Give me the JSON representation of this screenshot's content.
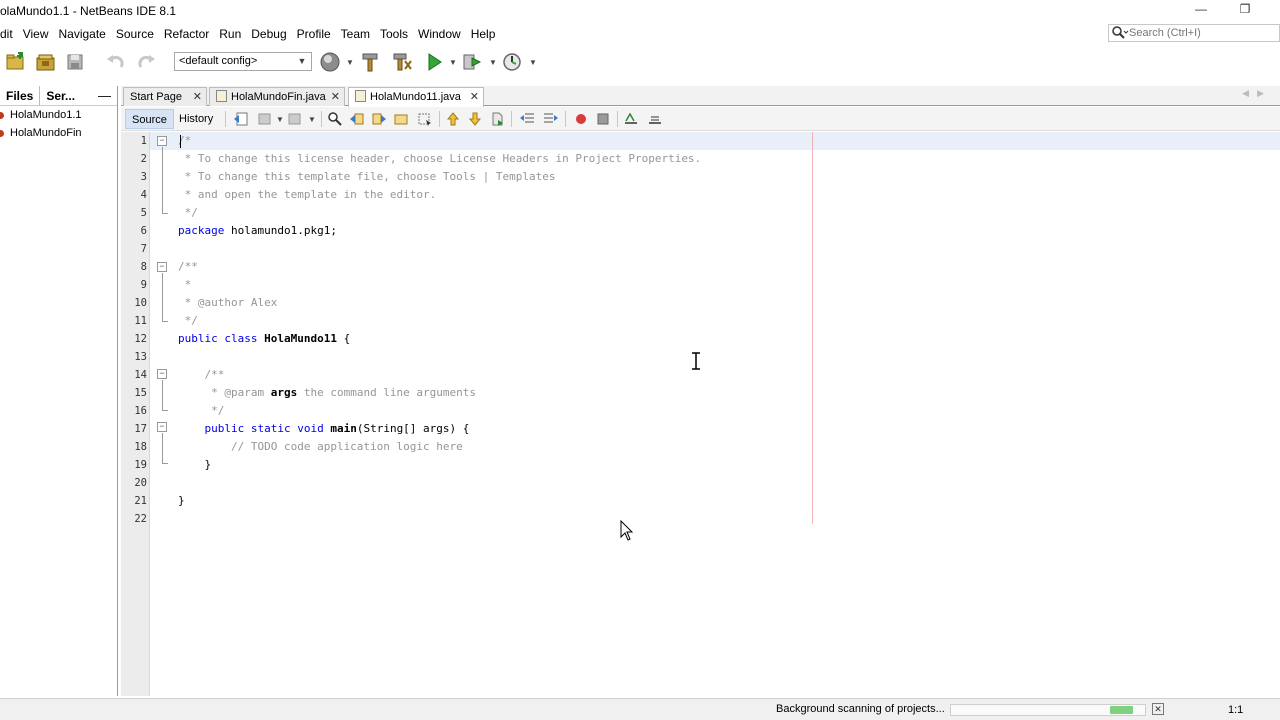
{
  "window": {
    "title": "olaMundo1.1 - NetBeans IDE 8.1",
    "minimize": "—",
    "restore": "❐"
  },
  "menu": [
    "dit",
    "View",
    "Navigate",
    "Source",
    "Refactor",
    "Run",
    "Debug",
    "Profile",
    "Team",
    "Tools",
    "Window",
    "Help"
  ],
  "search": {
    "placeholder": "Search (Ctrl+I)"
  },
  "toolbar": {
    "config": "<default config>"
  },
  "left_panel": {
    "tabs": [
      "Files",
      "Ser..."
    ],
    "minimize": "—",
    "projects": [
      "HolaMundo1.1",
      "HolaMundoFin"
    ]
  },
  "editor_tabs": [
    {
      "label": "Start Page",
      "close": "✕"
    },
    {
      "label": "HolaMundoFin.java",
      "close": "✕"
    },
    {
      "label": "HolaMundo11.java",
      "close": "✕"
    }
  ],
  "editor_toolbar": {
    "source": "Source",
    "history": "History"
  },
  "code": {
    "line_numbers": [
      "1",
      "2",
      "3",
      "4",
      "5",
      "6",
      "7",
      "8",
      "9",
      "10",
      "11",
      "12",
      "13",
      "14",
      "15",
      "16",
      "17",
      "18",
      "19",
      "20",
      "21",
      "22"
    ],
    "lines": {
      "l1": "/*",
      "l2": " * To change this license header, choose License Headers in Project Properties.",
      "l3": " * To change this template file, choose Tools | Templates",
      "l4": " * and open the template in the editor.",
      "l5": " */",
      "l6_kw": "package",
      "l6_rest": " holamundo1.pkg1;",
      "l8": "/**",
      "l9": " *",
      "l10": " * @author Alex",
      "l11": " */",
      "l12_kw": "public class",
      "l12_name": " HolaMundo11",
      "l12_rest": " {",
      "l14": "    /**",
      "l15_a": "     * @param ",
      "l15_b": "args",
      "l15_c": " the command line arguments",
      "l16": "     */",
      "l17_kw": "    public static void",
      "l17_name": " main",
      "l17_rest": "(String[] args) {",
      "l18": "        // TODO code application logic here",
      "l19": "    }",
      "l21": "}"
    }
  },
  "status": {
    "text": "Background scanning of projects...",
    "progress": 0.12,
    "position": "1:1",
    "close": "✕"
  }
}
